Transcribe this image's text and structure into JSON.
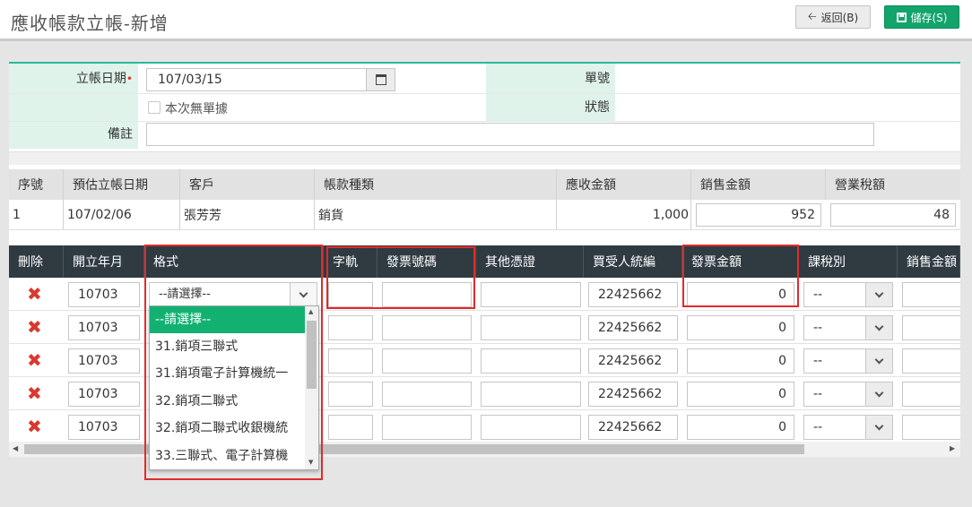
{
  "header": {
    "title": "應收帳款立帳-新增",
    "back_label": "返回(B)",
    "save_label": "儲存(S)",
    "back_icon": "arrow-left-icon",
    "save_icon": "floppy-disk-icon"
  },
  "form": {
    "date_label": "立帳日期",
    "date_required_mark": "•",
    "date_value": "107/03/15",
    "no_doc_checkbox_label": "本次無單據",
    "no_doc_checked": false,
    "memo_label": "備註",
    "memo_value": "",
    "doc_no_label": "單號",
    "doc_no_value": "",
    "status_label": "狀態",
    "status_value": ""
  },
  "summary_table": {
    "columns": [
      "序號",
      "預估立帳日期",
      "客戶",
      "帳款種類",
      "應收金額",
      "銷售金額",
      "營業稅額"
    ],
    "rows": [
      {
        "seq": "1",
        "date": "107/02/06",
        "customer": "張芳芳",
        "type": "銷貨",
        "receivable": "1,000",
        "sales": "952",
        "tax": "48"
      }
    ]
  },
  "invoice_table": {
    "columns": [
      "刪除",
      "開立年月",
      "格式",
      "字軌",
      "發票號碼",
      "其他憑證",
      "買受人統編",
      "發票金額",
      "課稅別",
      "銷售金額"
    ],
    "rows": [
      {
        "month": "10703",
        "format": "--請選擇--",
        "track": "",
        "inv_no": "",
        "other": "",
        "buyer_id": "22425662",
        "amount": "0",
        "tax_type": "--",
        "sales": ""
      },
      {
        "month": "10703",
        "format": "",
        "track": "",
        "inv_no": "",
        "other": "",
        "buyer_id": "22425662",
        "amount": "0",
        "tax_type": "--",
        "sales": ""
      },
      {
        "month": "10703",
        "format": "",
        "track": "",
        "inv_no": "",
        "other": "",
        "buyer_id": "22425662",
        "amount": "0",
        "tax_type": "--",
        "sales": ""
      },
      {
        "month": "10703",
        "format": "",
        "track": "",
        "inv_no": "",
        "other": "",
        "buyer_id": "22425662",
        "amount": "0",
        "tax_type": "--",
        "sales": ""
      },
      {
        "month": "10703",
        "format": "",
        "track": "",
        "inv_no": "",
        "other": "",
        "buyer_id": "22425662",
        "amount": "0",
        "tax_type": "--",
        "sales": ""
      }
    ]
  },
  "format_dropdown": {
    "options": [
      "--請選擇--",
      "31.銷項三聯式",
      "31.銷項電子計算機統一",
      "32.銷項二聯式",
      "32.銷項二聯式收銀機統",
      "33.三聯式、電子計算機"
    ],
    "selected_index": 0
  },
  "colors": {
    "accent": "#12a46b",
    "table_head_dark": "#2f3a41",
    "label_bg": "#dff3ea",
    "highlight": "#e02b2b",
    "delete": "#d9392f"
  }
}
